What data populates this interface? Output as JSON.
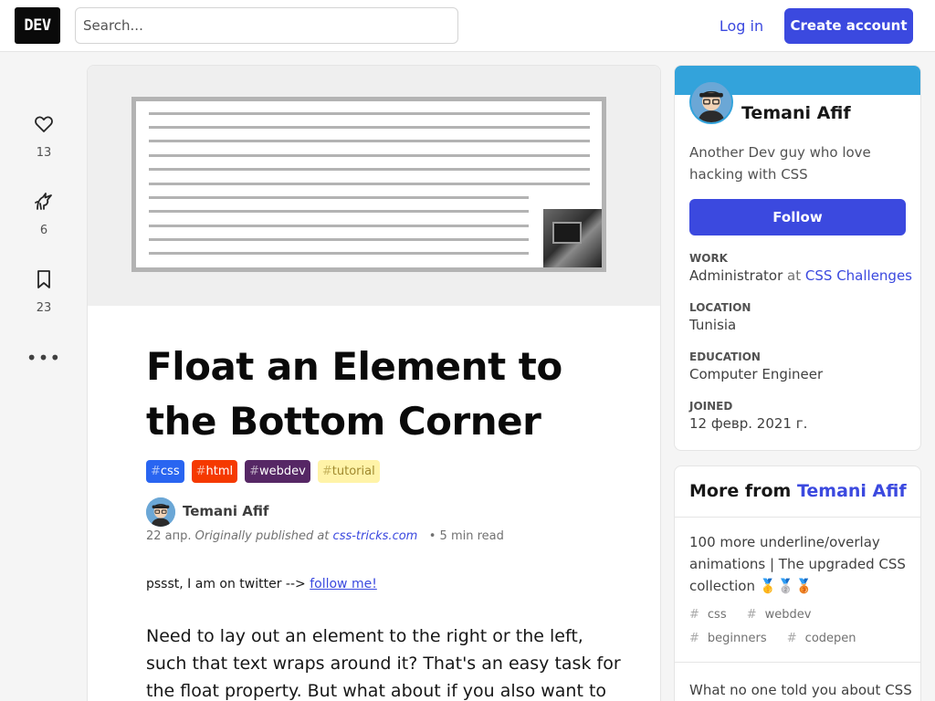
{
  "header": {
    "logo_text": "DEV",
    "search_placeholder": "Search...",
    "login_label": "Log in",
    "create_account_label": "Create account"
  },
  "reactions": {
    "likes": "13",
    "unicorns": "6",
    "saves": "23",
    "more": "•••"
  },
  "article": {
    "title": "Float an Element to the Bottom Corner",
    "tags": [
      {
        "name": "css",
        "bg": "#2965f1",
        "fg": "#ffffff"
      },
      {
        "name": "html",
        "bg": "#f53900",
        "fg": "#ffffff"
      },
      {
        "name": "webdev",
        "bg": "#562765",
        "fg": "#ffffff"
      },
      {
        "name": "tutorial",
        "bg": "#fff3a8",
        "fg": "#a0892e"
      }
    ],
    "author": "Temani Afif",
    "date": "22 апр.",
    "originally": "Originally published at",
    "source_link": "css-tricks.com",
    "read_time": "5 min read",
    "twitter_text": "pssst, I am on twitter -->",
    "twitter_link": "follow me!",
    "intro": "Need to lay out an element to the right or the left, such that text wraps around it? That's an easy task for the float property. But what about if you also want to push"
  },
  "profile": {
    "name": "Temani Afif",
    "bio": "Another Dev guy who love hacking with CSS",
    "follow_label": "Follow",
    "work_label": "Work",
    "work_role": "Administrator",
    "work_at": "at",
    "work_org": "CSS Challenges",
    "location_label": "Location",
    "location": "Tunisia",
    "education_label": "Education",
    "education": "Computer Engineer",
    "joined_label": "Joined",
    "joined": "12 февр. 2021 г."
  },
  "more_from": {
    "prefix": "More from",
    "author": "Temani Afif",
    "posts": [
      {
        "title": "100 more underline/overlay animations | The upgraded CSS collection",
        "medals": "🥇🥈🥉",
        "tags": [
          "css",
          "webdev",
          "beginners",
          "codepen"
        ]
      },
      {
        "title": "What no one told you about CSS"
      }
    ]
  },
  "colors": {
    "accent": "#3b49df",
    "brand_band": "#33a3db"
  }
}
